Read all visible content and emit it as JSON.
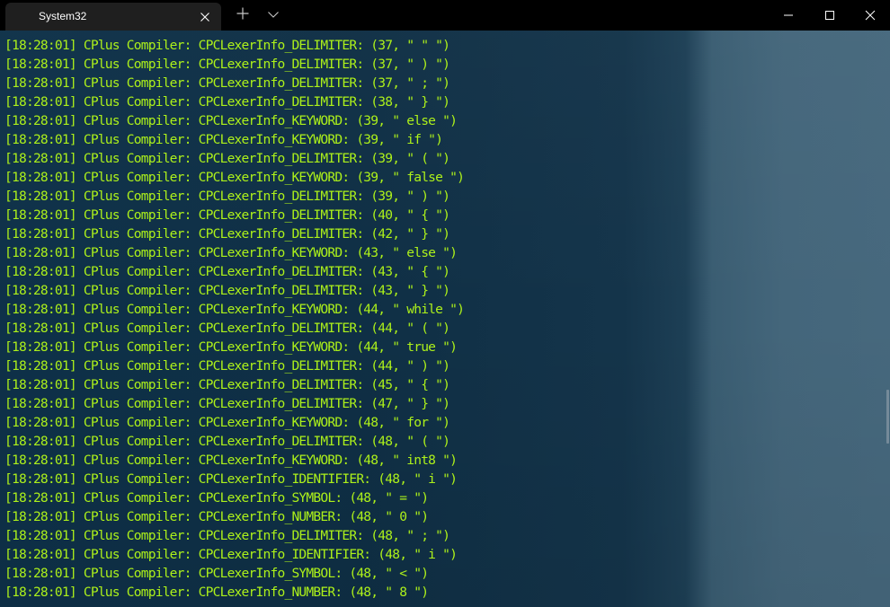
{
  "window": {
    "tab_title": "System32",
    "icons": {
      "tab_close": "close-icon",
      "new_tab": "plus-icon",
      "tab_dropdown": "chevron-down-icon",
      "minimize": "minimize-icon",
      "maximize": "maximize-icon",
      "close": "close-icon"
    }
  },
  "colors": {
    "text": "#adf11a",
    "titlebar": "#000000",
    "tab": "#1f1f1f",
    "terminal_background": "#0c2e46"
  },
  "log_lines": [
    "[18:28:01] CPlus Compiler: CPCLexerInfo_DELIMITER: (37, \" \" \")",
    "[18:28:01] CPlus Compiler: CPCLexerInfo_DELIMITER: (37, \" ) \")",
    "[18:28:01] CPlus Compiler: CPCLexerInfo_DELIMITER: (37, \" ; \")",
    "[18:28:01] CPlus Compiler: CPCLexerInfo_DELIMITER: (38, \" } \")",
    "[18:28:01] CPlus Compiler: CPCLexerInfo_KEYWORD: (39, \" else \")",
    "[18:28:01] CPlus Compiler: CPCLexerInfo_KEYWORD: (39, \" if \")",
    "[18:28:01] CPlus Compiler: CPCLexerInfo_DELIMITER: (39, \" ( \")",
    "[18:28:01] CPlus Compiler: CPCLexerInfo_KEYWORD: (39, \" false \")",
    "[18:28:01] CPlus Compiler: CPCLexerInfo_DELIMITER: (39, \" ) \")",
    "[18:28:01] CPlus Compiler: CPCLexerInfo_DELIMITER: (40, \" { \")",
    "[18:28:01] CPlus Compiler: CPCLexerInfo_DELIMITER: (42, \" } \")",
    "[18:28:01] CPlus Compiler: CPCLexerInfo_KEYWORD: (43, \" else \")",
    "[18:28:01] CPlus Compiler: CPCLexerInfo_DELIMITER: (43, \" { \")",
    "[18:28:01] CPlus Compiler: CPCLexerInfo_DELIMITER: (43, \" } \")",
    "[18:28:01] CPlus Compiler: CPCLexerInfo_KEYWORD: (44, \" while \")",
    "[18:28:01] CPlus Compiler: CPCLexerInfo_DELIMITER: (44, \" ( \")",
    "[18:28:01] CPlus Compiler: CPCLexerInfo_KEYWORD: (44, \" true \")",
    "[18:28:01] CPlus Compiler: CPCLexerInfo_DELIMITER: (44, \" ) \")",
    "[18:28:01] CPlus Compiler: CPCLexerInfo_DELIMITER: (45, \" { \")",
    "[18:28:01] CPlus Compiler: CPCLexerInfo_DELIMITER: (47, \" } \")",
    "[18:28:01] CPlus Compiler: CPCLexerInfo_KEYWORD: (48, \" for \")",
    "[18:28:01] CPlus Compiler: CPCLexerInfo_DELIMITER: (48, \" ( \")",
    "[18:28:01] CPlus Compiler: CPCLexerInfo_KEYWORD: (48, \" int8 \")",
    "[18:28:01] CPlus Compiler: CPCLexerInfo_IDENTIFIER: (48, \" i \")",
    "[18:28:01] CPlus Compiler: CPCLexerInfo_SYMBOL: (48, \" = \")",
    "[18:28:01] CPlus Compiler: CPCLexerInfo_NUMBER: (48, \" 0 \")",
    "[18:28:01] CPlus Compiler: CPCLexerInfo_DELIMITER: (48, \" ; \")",
    "[18:28:01] CPlus Compiler: CPCLexerInfo_IDENTIFIER: (48, \" i \")",
    "[18:28:01] CPlus Compiler: CPCLexerInfo_SYMBOL: (48, \" < \")",
    "[18:28:01] CPlus Compiler: CPCLexerInfo_NUMBER: (48, \" 8 \")"
  ]
}
